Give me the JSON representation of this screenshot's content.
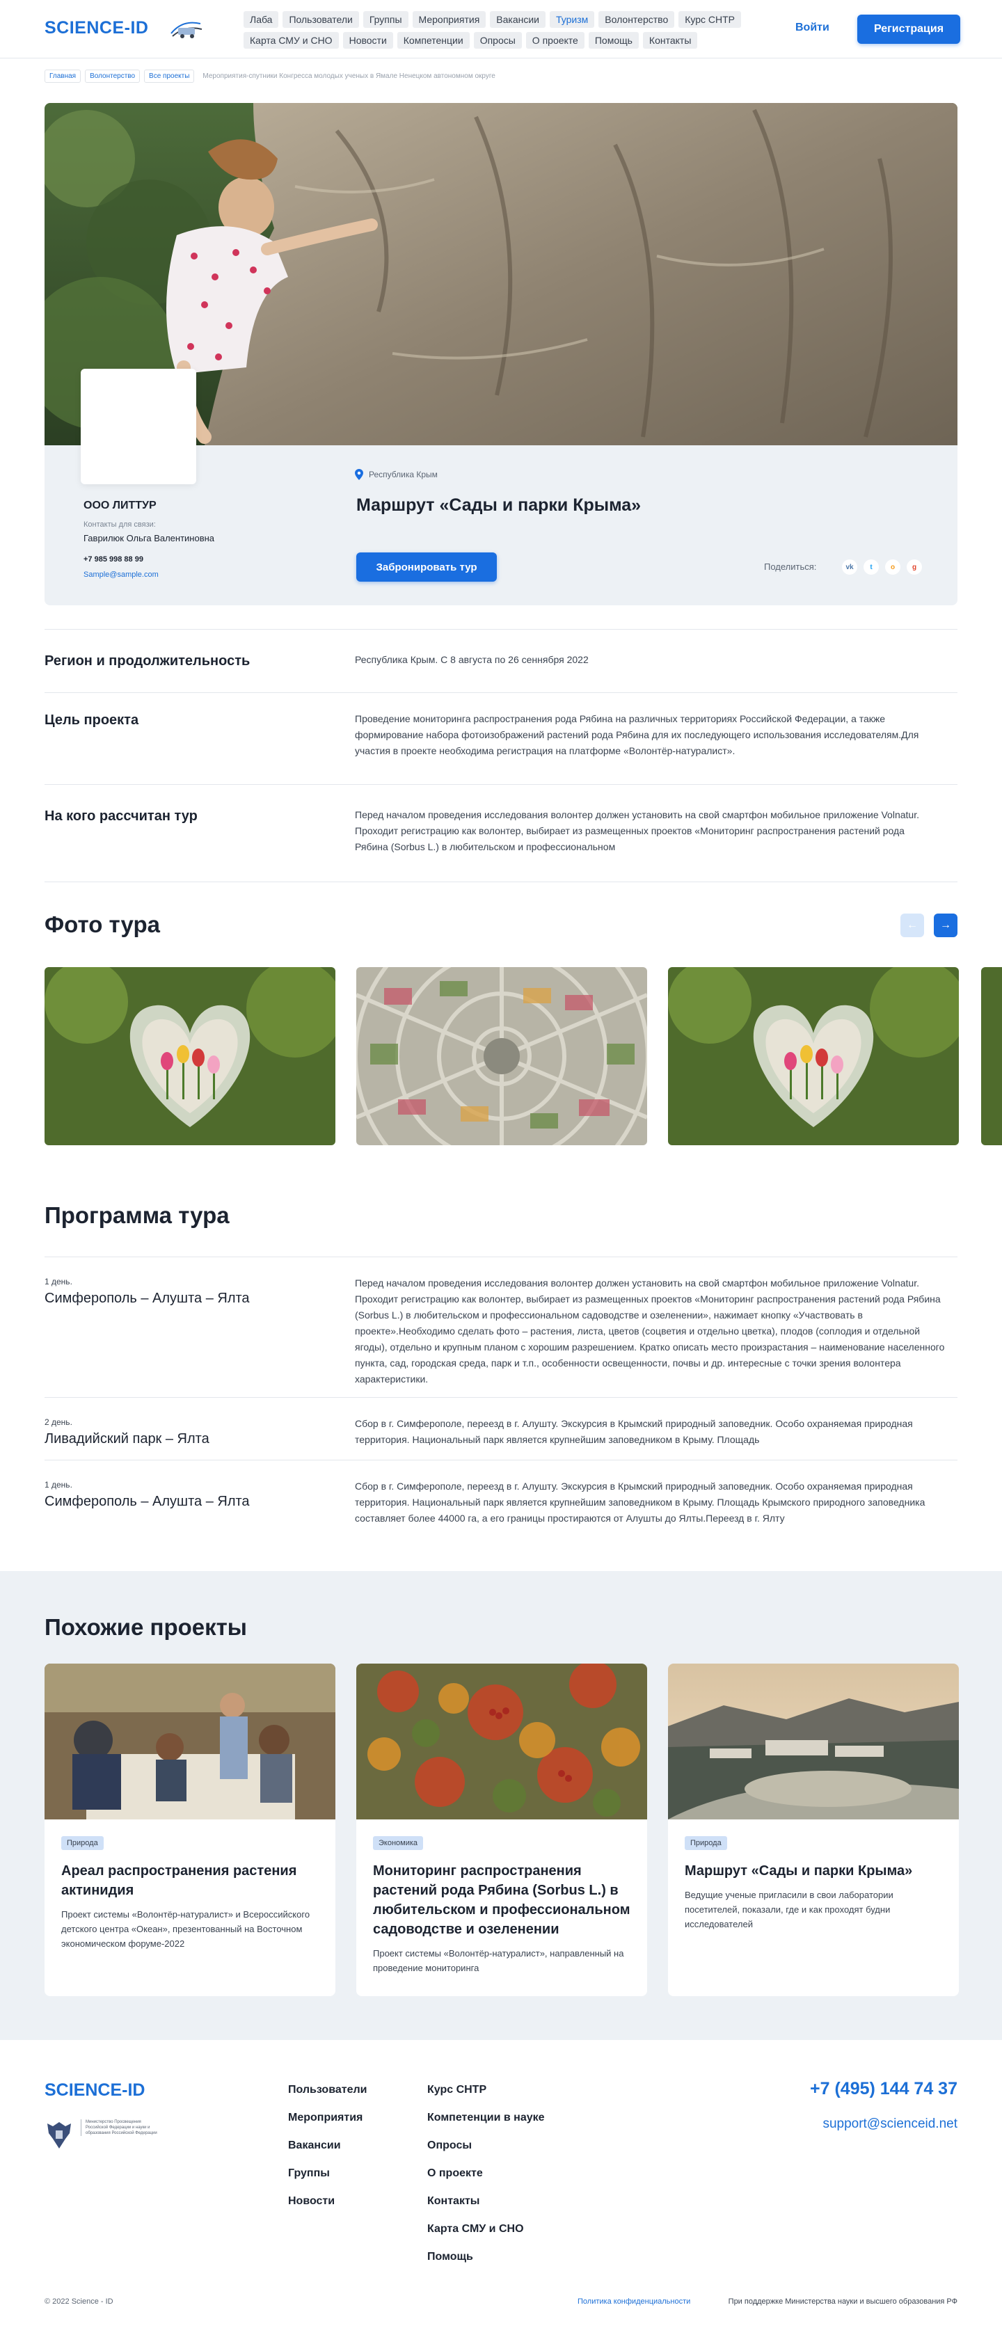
{
  "header": {
    "logo": "SCIENCE-ID",
    "nav": [
      "Лаба",
      "Пользователи",
      "Группы",
      "Мероприятия",
      "Вакансии",
      "Туризм",
      "Волонтерство",
      "Курс СНТР",
      "Карта СМУ и СНО",
      "Новости",
      "Компетенции",
      "Опросы",
      "О проекте",
      "Помощь",
      "Контакты"
    ],
    "active_nav": "Туризм",
    "login": "Войти",
    "register": "Регистрация"
  },
  "breadcrumbs": [
    "Главная",
    "Волонтерство",
    "Все проекты",
    "Мероприятия-спутники Конгресса молодых ученых в Ямале Ненецком автономном округе"
  ],
  "organizer": {
    "name": "ООО ЛИТТУР",
    "contacts_label": "Контакты для связи:",
    "person": "Гаврилюк Ольга Валентиновна",
    "phone": "+7 985 998 88 99",
    "email": "Sample@sample.com"
  },
  "tour": {
    "location": "Республика Крым",
    "title": "Маршрут «Сады и парки Крыма»",
    "book_label": "Забронировать тур",
    "share_label": "Поделиться:",
    "share_icons": [
      "vk-icon",
      "twitter-icon",
      "odnoklassniki-icon",
      "google-plus-icon"
    ],
    "share_glyphs": [
      "vk",
      "t",
      "o",
      "g"
    ]
  },
  "info": [
    {
      "label": "Регион и продолжительность",
      "text": "Республика Крым. С 8 августа по 26 сеннября 2022"
    },
    {
      "label": "Цель проекта",
      "text": "Проведение мониторинга распространения рода Рябина на различных территориях Российской Федерации, а также формирование набора фотоизображений растений рода Рябина для их последующего использования исследователям.Для участия в проекте необходима регистрация на платформе «Волонтёр-натуралист»."
    },
    {
      "label": "На кого рассчитан тур",
      "text": "Перед началом проведения исследования волонтер должен установить на свой смартфон мобильное приложение Volnatur. Проходит регистрацию как волонтер, выбирает из размещенных проектов «Мониторинг распространения растений рода Рябина (Sorbus L.) в любительском и профессиональном"
    }
  ],
  "photos_title": "Фото тура",
  "program_title": "Программа тура",
  "program": [
    {
      "day": "1 день.",
      "route": "Симферополь – Алушта – Ялта",
      "text": "Перед началом проведения исследования волонтер должен установить на свой смартфон мобильное приложение Volnatur. Проходит регистрацию как волонтер, выбирает из размещенных проектов «Мониторинг распространения растений рода Рябина (Sorbus L.) в любительском и профессиональном садоводстве и озеленении», нажимает кнопку «Участвовать в проекте».Необходимо сделать фото – растения, листа, цветов (соцветия и отдельно цветка), плодов (соплодия и отдельной ягоды), отдельно и крупным планом с хорошим разрешением. Кратко описать место произрастания – наименование населенного пункта, сад, городская среда, парк и т.п., особенности освещенности, почвы и др. интересные с точки зрения волонтера характеристики."
    },
    {
      "day": "2 день.",
      "route": "Ливадийский парк – Ялта",
      "text": "Сбор в г. Симферополе, переезд в г. Алушту. Экскурсия в Крымский природный заповедник. Особо охраняемая природная территория. Национальный парк является крупнейшим заповедником в Крыму. Площадь"
    },
    {
      "day": "1 день.",
      "route": "Симферополь – Алушта – Ялта",
      "text": "Сбор в г. Симферополе, переезд в г. Алушту. Экскурсия в Крымский природный заповедник. Особо охраняемая природная территория. Национальный парк является крупнейшим заповедником в Крыму. Площадь Крымского природного заповедника составляет более 44000 га, а его границы простираются от Алушты до Ялты.Переезд в г. Ялту"
    }
  ],
  "similar_title": "Похожие проекты",
  "similar": [
    {
      "badge": "Природа",
      "title": "Ареал распространения растения актинидия",
      "text": "Проект системы «Волонтёр-натуралист» и Всероссийского детского центра «Океан», презентованный на Восточном экономическом форуме-2022"
    },
    {
      "badge": "Экономика",
      "title": "Мониторинг распространения растений рода Рябина (Sorbus L.) в любительском и профессиональном садоводстве и озеленении",
      "text": "Проект системы «Волонтёр-натуралист», направленный на проведение мониторинга"
    },
    {
      "badge": "Природа",
      "title": "Маршрут «Сады и парки Крыма»",
      "text": "Ведущие ученые пригласили в свои лаборатории посетителей, показали, где и как проходят будни исследователей"
    }
  ],
  "footer": {
    "logo": "SCIENCE-ID",
    "ministry_text": "Министерство Просвещения Российской Федерации и науки и образования Российской Федерации",
    "col1": [
      "Пользователи",
      "Мероприятия",
      "Вакансии",
      "Группы",
      "Новости"
    ],
    "col2": [
      "Курс СНТР",
      "Компетенции в науке",
      "Опросы",
      "О проекте",
      "Контакты",
      "Карта СМУ и СНО",
      "Помощь"
    ],
    "phone": "+7 (495) 144 74 37",
    "email": "support@scienceid.net",
    "copyright": "© 2022 Science - ID",
    "privacy": "Политика конфиденциальности",
    "support": "При поддержке Министерства науки и высшего образования РФ"
  },
  "colors": {
    "accent": "#1a6ee0",
    "panel": "#edf1f5",
    "text": "#1c2330"
  }
}
